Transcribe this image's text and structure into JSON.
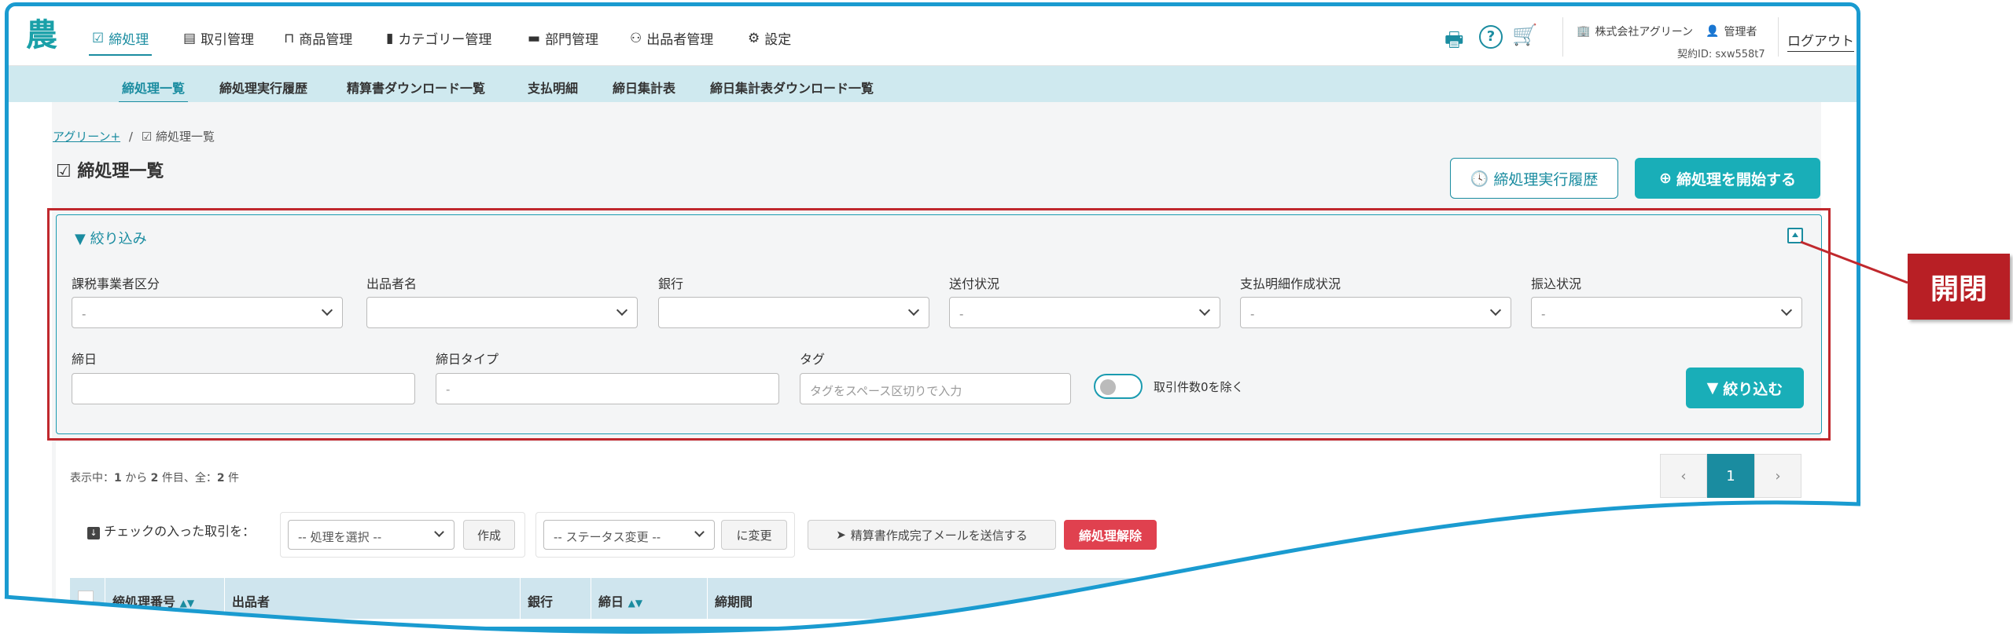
{
  "nav": {
    "logo": "農",
    "items": [
      {
        "label": "締処理",
        "icon": "check-circle-icon"
      },
      {
        "label": "取引管理",
        "icon": "document-icon"
      },
      {
        "label": "商品管理",
        "icon": "basket-icon"
      },
      {
        "label": "カテゴリー管理",
        "icon": "book-icon"
      },
      {
        "label": "部門管理",
        "icon": "folder-icon"
      },
      {
        "label": "出品者管理",
        "icon": "users-icon"
      },
      {
        "label": "設定",
        "icon": "gear-icon"
      }
    ],
    "company": "株式会社アグリーン",
    "role": "管理者",
    "contract": "契約ID: sxw558t7",
    "logout": "ログアウト"
  },
  "subnav": {
    "items": [
      "締処理一覧",
      "締処理実行履歴",
      "精算書ダウンロード一覧",
      "支払明細",
      "締日集計表",
      "締日集計表ダウンロード一覧"
    ]
  },
  "breadcrumb": {
    "root": "アグリーン+",
    "sep": "/",
    "current": "締処理一覧"
  },
  "page": {
    "title": "締処理一覧",
    "history_button": "締処理実行履歴",
    "start_button": "締処理を開始する"
  },
  "filter": {
    "title": "絞り込み",
    "fields": [
      {
        "label": "課税事業者区分",
        "value": "-"
      },
      {
        "label": "出品者名",
        "value": ""
      },
      {
        "label": "銀行",
        "value": ""
      },
      {
        "label": "送付状況",
        "value": "-"
      },
      {
        "label": "支払明細作成状況",
        "value": "-"
      },
      {
        "label": "振込状況",
        "value": "-"
      }
    ],
    "closing_date_label": "締日",
    "closing_type_label": "締日タイプ",
    "closing_type_value": "-",
    "tag_label": "タグ",
    "tag_placeholder": "タグをスペース区切りで入力",
    "toggle_label": "取引件数0を除く",
    "submit": "絞り込む"
  },
  "list": {
    "showing_prefix": "表示中：",
    "showing_from": "1",
    "showing_mid1": " から ",
    "showing_to": "2",
    "showing_mid2": " 件目、全：",
    "showing_total": "2",
    "showing_suffix": " 件",
    "pager": {
      "prev": "‹",
      "current": "1",
      "next": "›"
    },
    "bulk_label": "チェックの入った取引を：",
    "action_select": "-- 処理を選択 --",
    "create": "作成",
    "status_select": "-- ステータス変更 --",
    "apply": "に変更",
    "mail_button": "精算書作成完了メールを送信する",
    "release_button": "締処理解除",
    "columns": [
      "締処理番号",
      "出品者",
      "銀行",
      "締日",
      "締期間"
    ]
  },
  "callout": {
    "label": "開閉"
  },
  "colors": {
    "accent": "#1a8ca0",
    "primary": "#19aeb8",
    "danger": "#e0414f",
    "callout": "#b81f25"
  }
}
